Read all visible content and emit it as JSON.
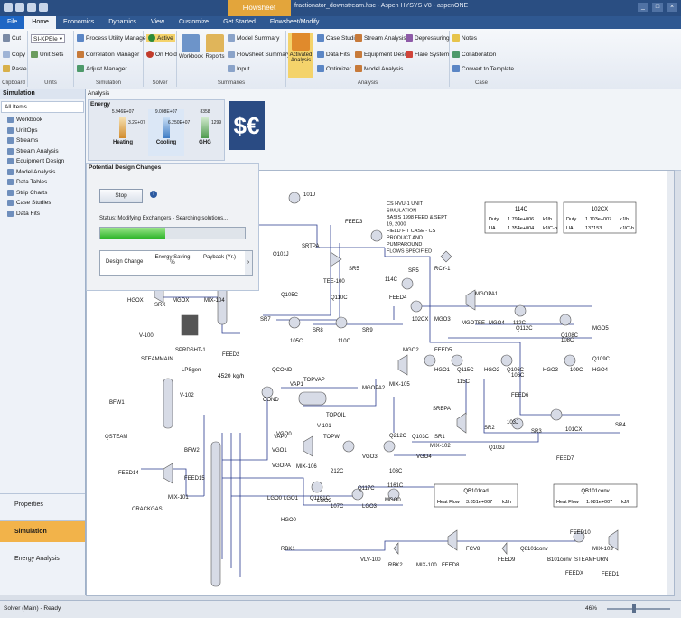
{
  "window": {
    "context_tab": "Flowsheet",
    "title": "fractionator_downstream.hsc - Aspen HYSYS V8 - aspenONE"
  },
  "tabs": [
    "File",
    "Home",
    "Economics",
    "Dynamics",
    "View",
    "Customize",
    "Get Started",
    "Flowsheet/Modify"
  ],
  "ribbon": {
    "clipboard": {
      "cut": "Cut",
      "copy": "Copy",
      "paste": "Paste",
      "label": "Clipboard"
    },
    "units": {
      "set": "SI-KPEIe",
      "unit_sets": "Unit Sets",
      "label": "Units"
    },
    "simulation": {
      "items": [
        "Process Utility Manager",
        "Correlation Manager",
        "Adjust Manager"
      ],
      "label": "Simulation"
    },
    "solver": {
      "active": "Active",
      "on_hold": "On Hold",
      "label": "Solver"
    },
    "summaries": {
      "workbook": "Workbook",
      "reports": "Reports",
      "items": [
        "Model Summary",
        "Flowsheet Summary",
        "Input"
      ],
      "label": "Summaries"
    },
    "analysis": {
      "activated": "Activated Analysis",
      "col1": [
        "Case Studies",
        "Data Fits",
        "Optimizer"
      ],
      "col2": [
        "Stream Analysis",
        "Equipment Design",
        "Model Analysis"
      ],
      "col3": [
        "Depressuring",
        "Flare System"
      ],
      "label": "Analysis"
    },
    "case": {
      "items": [
        "Notes",
        "Collaboration",
        "Convert to Template"
      ],
      "label": "Case"
    }
  },
  "leftpane": {
    "title": "Simulation",
    "filter": "All Items",
    "items": [
      "Workbook",
      "UnitOps",
      "Streams",
      "Stream Analysis",
      "Equipment Design",
      "Model Analysis",
      "Data Tables",
      "Strip Charts",
      "Case Studies",
      "Data Fits"
    ],
    "workspaces": [
      "Properties",
      "Simulation",
      "Energy Analysis"
    ]
  },
  "analysis_panel": {
    "title": "Analysis",
    "energy_label": "Energy",
    "heating": {
      "label": "Heating",
      "top": "5.946E+07",
      "side": "3.2E+07"
    },
    "cooling": {
      "label": "Cooling",
      "top": "9.008E+07",
      "side": "6.250E+07"
    },
    "ghg": {
      "label": "GHG",
      "top": "8358",
      "side": "1299"
    }
  },
  "design": {
    "title": "Potential Design Changes",
    "stop": "Stop",
    "status": "Status: Modifying Exchangers - Searching solutions...",
    "progress": 0.45,
    "cols": [
      "Design Change",
      "Energy Saving %",
      "Payback (Yr.)"
    ]
  },
  "flowsheet": {
    "note": [
      "CS HVU-1 UNIT",
      "SIMULATION",
      "BASIS 1998 FEED & SEPT",
      "19, 2000",
      "FIELD FIT CASE - CS",
      "PRODUCT AND",
      "PUMPAROUND",
      "FLOWS SPECIFIED"
    ],
    "t114c": {
      "title": "114C",
      "r1": [
        "Duty",
        "1.794e+006",
        "kJ/h"
      ],
      "r2": [
        "UA",
        "1.354e+004",
        "kJ/C-h"
      ]
    },
    "t102cx": {
      "title": "102CX",
      "r1": [
        "Duty",
        "1.103e+007",
        "kJ/h"
      ],
      "r2": [
        "UA",
        "137153",
        "kJ/C-h"
      ]
    },
    "tqb101rad": {
      "title": "QB101rad",
      "r1": [
        "Heat Flow",
        "3.851e+007",
        "kJ/h"
      ]
    },
    "tqb101conv": {
      "title": "QB101conv",
      "r1": [
        "Heat Flow",
        "1.081e+007",
        "kJ/h"
      ]
    },
    "flow_value": "4520",
    "flow_unit": "kg/h",
    "labels": [
      "101J",
      "FEED3",
      "Q101J",
      "SRTPA",
      "TEE-100",
      "SR5",
      "114C",
      "SR5",
      "RCY-1",
      "FEED4",
      "MGOPA1",
      "SR7",
      "Q105C",
      "Q110C",
      "102CX",
      "MGO3",
      "MGOTEE",
      "MGO4",
      "Q112C",
      "Q108C",
      "105C",
      "SR8",
      "110C",
      "SR9",
      "112C",
      "MGO5",
      "108C",
      "MGO2",
      "FEED5",
      "Q109C",
      "Q115C",
      "Q106C",
      "MGOPA2",
      "MIX-105",
      "HGO1",
      "115C",
      "HGO2",
      "106C",
      "HGO3",
      "109C",
      "HGO4",
      "FEED6",
      "SPRDSHT-1",
      "FEED2",
      "LPSgen",
      "V-102",
      "QCOND",
      "VAP1",
      "TOPVAP",
      "COND",
      "V-101",
      "TOPOIL",
      "BFW1",
      "SRBPA",
      "SR1",
      "SR2",
      "103J",
      "SR3",
      "101CX",
      "SR4",
      "QSTEAM",
      "BFW2",
      "TOPW",
      "VAP0",
      "VGO0",
      "Q103C",
      "MIX-102",
      "Q103J",
      "FEED7",
      "VGO1",
      "Q212C",
      "VGOPA",
      "MIX-106",
      "212C",
      "VGO3",
      "103C",
      "VGO4",
      "FEED14",
      "FEED15",
      "MIX-101",
      "CRACKGAS",
      "LGO0",
      "LGO1",
      "Q1161C",
      "Q117C",
      "1161C",
      "LGO2",
      "107C",
      "LGO3",
      "MGO0",
      "HGO0",
      "RBK1",
      "VLV-100",
      "RBK2",
      "MIX-100",
      "FEED8",
      "FCV8",
      "FEED9",
      "Q8101conv",
      "B101conv",
      "FEED10",
      "STEAMFURN",
      "MIX-103",
      "FEEDX",
      "FEED1",
      "MGOX",
      "MIX-104",
      "HGOX",
      "SRX",
      "V-100",
      "STEAMMAIN"
    ]
  },
  "status": {
    "text": "Solver (Main) - Ready",
    "zoom": "46%"
  }
}
